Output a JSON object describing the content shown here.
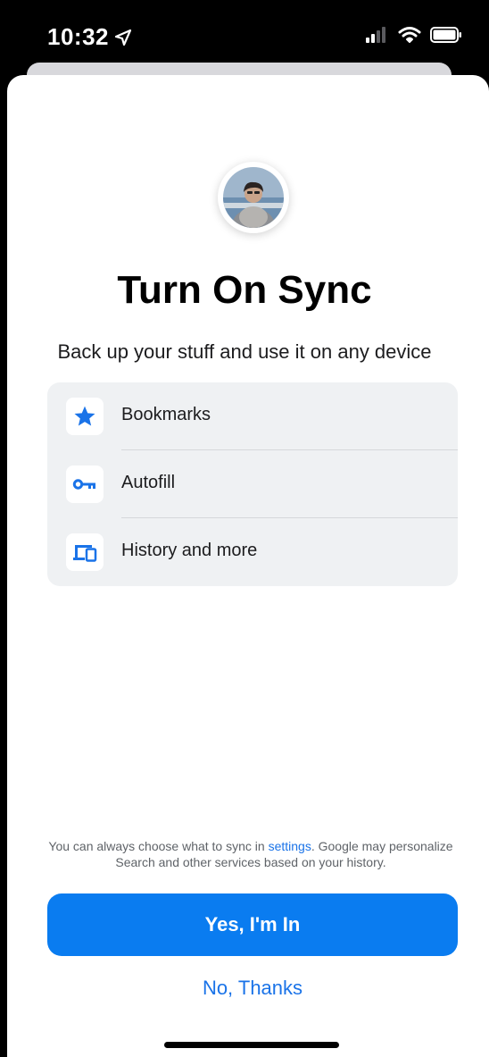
{
  "status_bar": {
    "time": "10:32"
  },
  "sheet": {
    "title": "Turn On Sync",
    "subtitle": "Back up your stuff and use it on any device",
    "features": [
      {
        "label": "Bookmarks",
        "icon": "star-icon"
      },
      {
        "label": "Autofill",
        "icon": "key-icon"
      },
      {
        "label": "History and more",
        "icon": "devices-icon"
      }
    ],
    "footnote": {
      "before_link": "You can always choose what to sync in ",
      "link": "settings",
      "after_link": ". Google may personalize Search and other services based on your history."
    },
    "primary_button": "Yes, I'm In",
    "secondary_button": "No, Thanks"
  },
  "colors": {
    "accent": "#0a7cf0",
    "link": "#1a73e8",
    "feature_bg": "#eff1f3"
  }
}
